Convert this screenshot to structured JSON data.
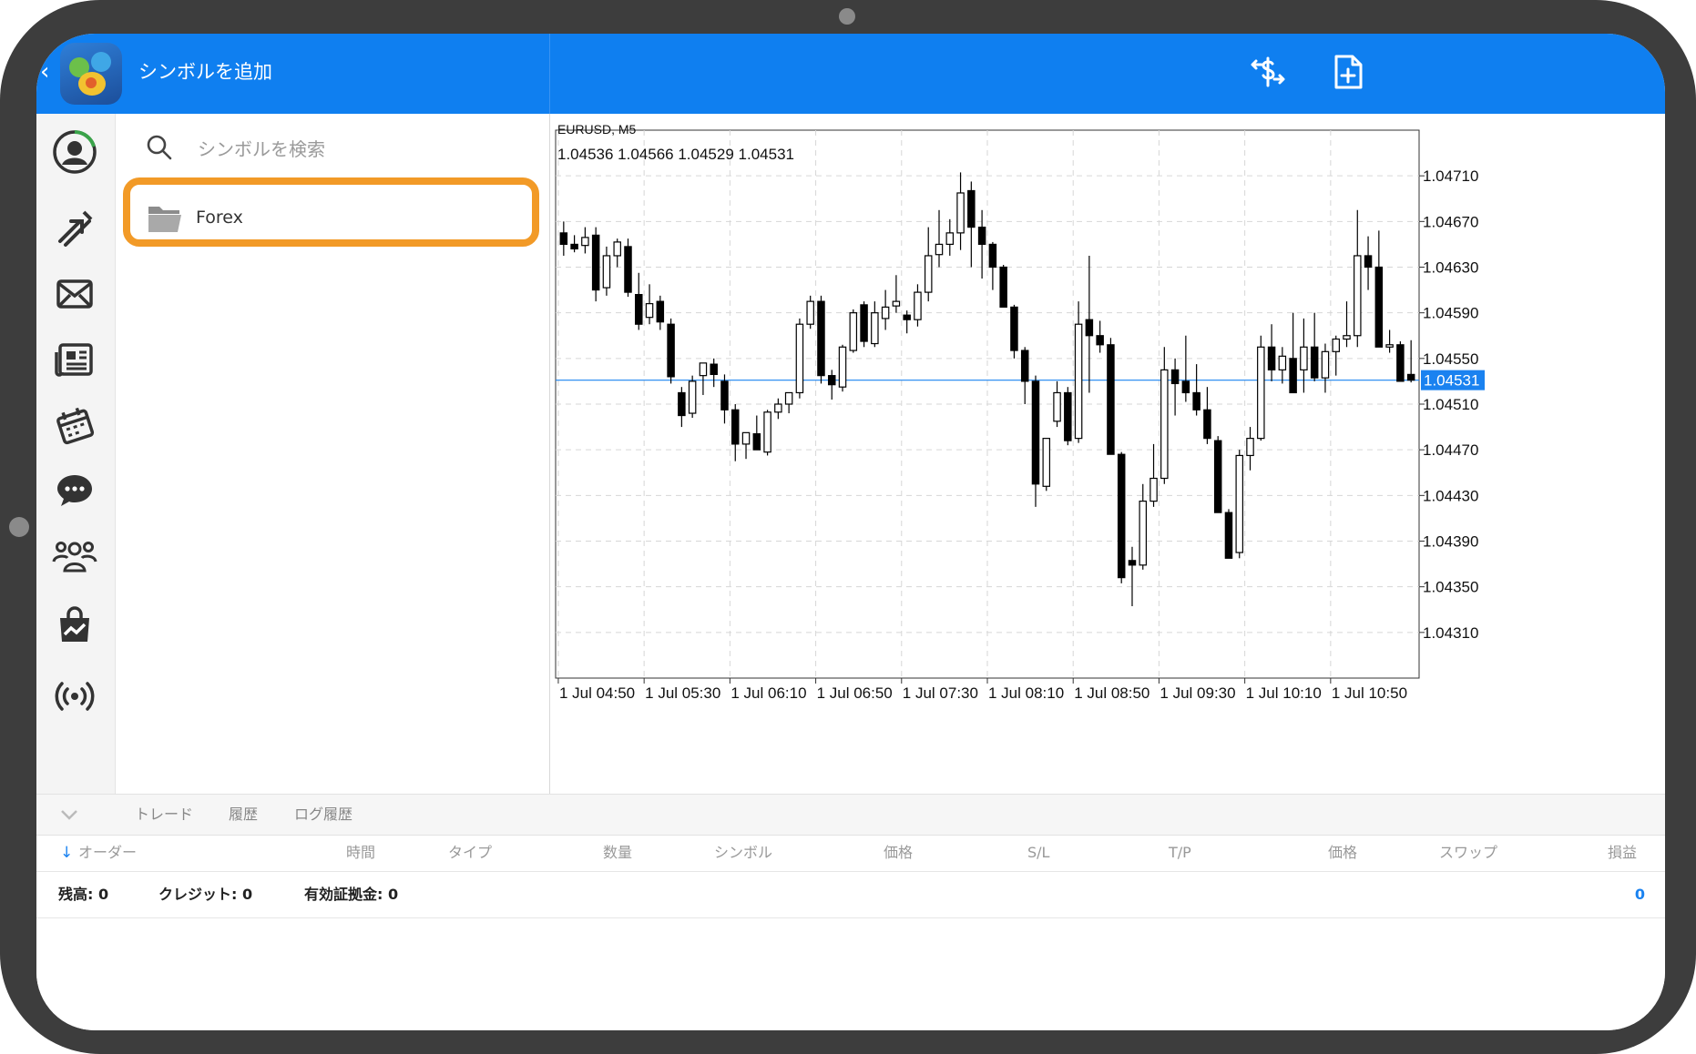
{
  "header": {
    "title": "シンボルを追加",
    "accent": "#0f7ff0"
  },
  "search": {
    "placeholder": "シンボルを検索"
  },
  "symbols": {
    "items": [
      {
        "label": "Forex",
        "icon": "folder-icon",
        "highlight_color": "#f29a27"
      }
    ]
  },
  "chart": {
    "symbol_label": "EURUSD, M5",
    "ohlc_label": "1.04536 1.04566 1.04529 1.04531"
  },
  "chart_data": {
    "type": "candlestick",
    "symbol": "EURUSD",
    "timeframe": "M5",
    "ohlc": [
      1.04536,
      1.04566,
      1.04529,
      1.04531
    ],
    "current_price": 1.04531,
    "current_price_label": "1.04531",
    "ylim": [
      1.0427,
      1.0475
    ],
    "yticks": [
      1.0431,
      1.0435,
      1.0439,
      1.0443,
      1.0447,
      1.0451,
      1.0455,
      1.0459,
      1.0463,
      1.0467,
      1.0471
    ],
    "ytick_labels": [
      "1.04310",
      "1.04350",
      "1.04390",
      "1.04430",
      "1.04470",
      "1.04510",
      "1.04550",
      "1.04590",
      "1.04630",
      "1.04670",
      "1.04710"
    ],
    "xtick_labels": [
      "1 Jul 04:50",
      "1 Jul 05:30",
      "1 Jul 06:10",
      "1 Jul 06:50",
      "1 Jul 07:30",
      "1 Jul 08:10",
      "1 Jul 08:50",
      "1 Jul 09:30",
      "1 Jul 10:10",
      "1 Jul 10:50"
    ],
    "candles_per_xtick": 8,
    "grid": true,
    "colors": {
      "line": "#1a82f0",
      "bull": "#ffffff",
      "bear": "#000000"
    },
    "candles": [
      [
        1.0466,
        1.0467,
        1.0464,
        1.0465
      ],
      [
        1.0465,
        1.04658,
        1.04643,
        1.04646
      ],
      [
        1.04649,
        1.04665,
        1.04642,
        1.04656
      ],
      [
        1.04658,
        1.04665,
        1.046,
        1.0461
      ],
      [
        1.04612,
        1.04648,
        1.04605,
        1.0464
      ],
      [
        1.0464,
        1.04655,
        1.0463,
        1.04652
      ],
      [
        1.04648,
        1.04655,
        1.04604,
        1.04608
      ],
      [
        1.04606,
        1.04625,
        1.04575,
        1.0458
      ],
      [
        1.04586,
        1.04615,
        1.0458,
        1.04598
      ],
      [
        1.046,
        1.04605,
        1.04575,
        1.04582
      ],
      [
        1.0458,
        1.04585,
        1.04528,
        1.04534
      ],
      [
        1.0452,
        1.04525,
        1.0449,
        1.045
      ],
      [
        1.04502,
        1.04535,
        1.04498,
        1.0453
      ],
      [
        1.04535,
        1.04542,
        1.04518,
        1.04546
      ],
      [
        1.04545,
        1.0455,
        1.04525,
        1.04536
      ],
      [
        1.0453,
        1.04536,
        1.04493,
        1.04505
      ],
      [
        1.04505,
        1.0451,
        1.0446,
        1.04475
      ],
      [
        1.04475,
        1.04478,
        1.04462,
        1.04485
      ],
      [
        1.04484,
        1.045,
        1.0447,
        1.0447
      ],
      [
        1.04468,
        1.04505,
        1.04465,
        1.04503
      ],
      [
        1.04503,
        1.04515,
        1.04497,
        1.0451
      ],
      [
        1.0451,
        1.04518,
        1.04502,
        1.0452
      ],
      [
        1.0452,
        1.04585,
        1.04515,
        1.0458
      ],
      [
        1.0458,
        1.04605,
        1.04576,
        1.046
      ],
      [
        1.046,
        1.04605,
        1.04528,
        1.04535
      ],
      [
        1.04535,
        1.0454,
        1.04514,
        1.04527
      ],
      [
        1.04525,
        1.04562,
        1.04521,
        1.0456
      ],
      [
        1.04557,
        1.04593,
        1.04555,
        1.0459
      ],
      [
        1.04597,
        1.046,
        1.0456,
        1.04565
      ],
      [
        1.04563,
        1.046,
        1.0456,
        1.0459
      ],
      [
        1.04585,
        1.0461,
        1.04575,
        1.04595
      ],
      [
        1.04596,
        1.04623,
        1.0459,
        1.046
      ],
      [
        1.04588,
        1.04592,
        1.04572,
        1.04584
      ],
      [
        1.04584,
        1.04615,
        1.04578,
        1.04608
      ],
      [
        1.04608,
        1.04665,
        1.046,
        1.0464
      ],
      [
        1.04641,
        1.0468,
        1.0463,
        1.0465
      ],
      [
        1.0465,
        1.04672,
        1.0464,
        1.0466
      ],
      [
        1.0466,
        1.04713,
        1.04645,
        1.04695
      ],
      [
        1.04697,
        1.04705,
        1.0463,
        1.04665
      ],
      [
        1.04665,
        1.0468,
        1.0462,
        1.0465
      ],
      [
        1.0465,
        1.04652,
        1.0461,
        1.0463
      ],
      [
        1.0463,
        1.04632,
        1.04595,
        1.04595
      ],
      [
        1.04595,
        1.04597,
        1.0455,
        1.04557
      ],
      [
        1.04557,
        1.0456,
        1.0451,
        1.0453
      ],
      [
        1.0453,
        1.04535,
        1.0442,
        1.0444
      ],
      [
        1.04438,
        1.0448,
        1.04434,
        1.0448
      ],
      [
        1.04495,
        1.0453,
        1.0449,
        1.0452
      ],
      [
        1.0452,
        1.04525,
        1.04474,
        1.04478
      ],
      [
        1.0448,
        1.046,
        1.04476,
        1.0458
      ],
      [
        1.04584,
        1.0464,
        1.0452,
        1.0457
      ],
      [
        1.0457,
        1.04583,
        1.04555,
        1.04562
      ],
      [
        1.04562,
        1.04568,
        1.04468,
        1.04466
      ],
      [
        1.04466,
        1.04468,
        1.04353,
        1.04358
      ],
      [
        1.04373,
        1.04385,
        1.04333,
        1.04369
      ],
      [
        1.04369,
        1.0444,
        1.04365,
        1.04425
      ],
      [
        1.04425,
        1.04475,
        1.0442,
        1.04445
      ],
      [
        1.04445,
        1.0456,
        1.0444,
        1.0454
      ],
      [
        1.0454,
        1.0455,
        1.045,
        1.04528
      ],
      [
        1.0453,
        1.0457,
        1.04512,
        1.0452
      ],
      [
        1.0452,
        1.04545,
        1.045,
        1.04505
      ],
      [
        1.04505,
        1.04525,
        1.04475,
        1.0448
      ],
      [
        1.04478,
        1.04482,
        1.04415,
        1.04415
      ],
      [
        1.04415,
        1.04418,
        1.04375,
        1.04375
      ],
      [
        1.0438,
        1.0447,
        1.04375,
        1.04465
      ],
      [
        1.04465,
        1.0449,
        1.04452,
        1.0448
      ],
      [
        1.0448,
        1.0457,
        1.04478,
        1.0456
      ],
      [
        1.0456,
        1.0458,
        1.0453,
        1.0454
      ],
      [
        1.0454,
        1.0456,
        1.04528,
        1.04552
      ],
      [
        1.0455,
        1.0459,
        1.0452,
        1.0452
      ],
      [
        1.0454,
        1.04585,
        1.0452,
        1.0456
      ],
      [
        1.0456,
        1.0459,
        1.0453,
        1.04533
      ],
      [
        1.04533,
        1.04563,
        1.0452,
        1.04556
      ],
      [
        1.04556,
        1.0457,
        1.04535,
        1.04567
      ],
      [
        1.04567,
        1.046,
        1.0456,
        1.0457
      ],
      [
        1.0457,
        1.0468,
        1.0456,
        1.0464
      ],
      [
        1.0464,
        1.04657,
        1.0461,
        1.0463
      ],
      [
        1.0463,
        1.04662,
        1.04565,
        1.0456
      ],
      [
        1.0456,
        1.04575,
        1.04555,
        1.04562
      ],
      [
        1.04562,
        1.04565,
        1.0453,
        1.0453
      ],
      [
        1.04536,
        1.04566,
        1.04529,
        1.04531
      ]
    ]
  },
  "tabs": [
    {
      "label": "トレード"
    },
    {
      "label": "履歴"
    },
    {
      "label": "ログ履歴"
    }
  ],
  "columns": {
    "order": "オーダー",
    "time": "時間",
    "type": "タイプ",
    "volume": "数量",
    "symbol": "シンボル",
    "price": "価格",
    "sl": "S/L",
    "tp": "T/P",
    "price2": "価格",
    "swap": "スワップ",
    "profit": "損益"
  },
  "summary": {
    "balance": "残高: 0",
    "credit": "クレジット: 0",
    "equity": "有効証拠金: 0",
    "total": "0"
  }
}
